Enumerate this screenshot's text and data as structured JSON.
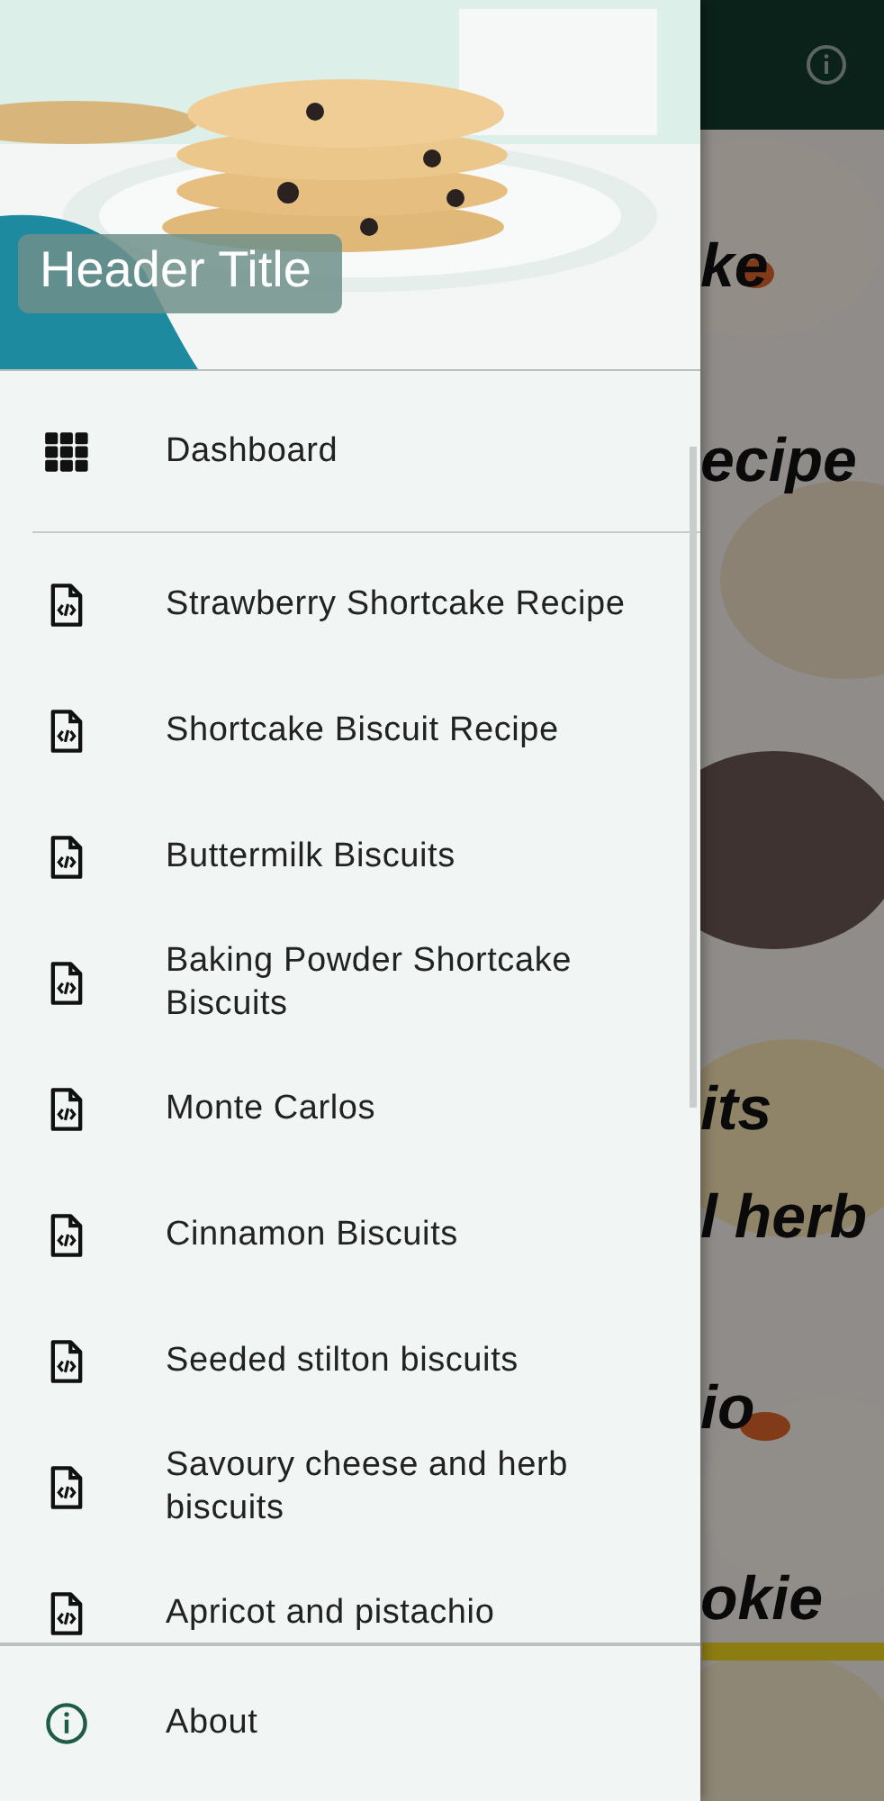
{
  "drawer": {
    "header_title": "Header Title",
    "dashboard": {
      "label": "Dashboard"
    },
    "recipes": [
      {
        "label": "Strawberry Shortcake Recipe"
      },
      {
        "label": "Shortcake Biscuit Recipe"
      },
      {
        "label": "Buttermilk Biscuits"
      },
      {
        "label": "Baking Powder Shortcake Biscuits"
      },
      {
        "label": "Monte Carlos"
      },
      {
        "label": "Cinnamon Biscuits"
      },
      {
        "label": "Seeded stilton biscuits"
      },
      {
        "label": "Savoury cheese and herb biscuits"
      },
      {
        "label": "Apricot and pistachio"
      }
    ],
    "about": {
      "label": "About"
    }
  },
  "background_titles": [
    "ke",
    "ecipe",
    "its",
    "l herb",
    "io",
    "okie"
  ]
}
